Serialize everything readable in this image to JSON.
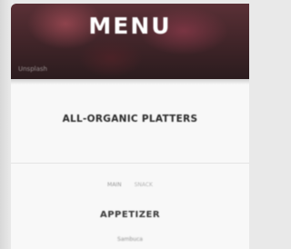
{
  "header": {
    "title": "MENU",
    "credit": "Unsplash"
  },
  "menu": {
    "section_title": "ALL-ORGANIC PLATTERS",
    "tabs": [
      "MAIN",
      "SNACK"
    ],
    "category": "APPETIZER",
    "first_item": "Sambuca"
  }
}
